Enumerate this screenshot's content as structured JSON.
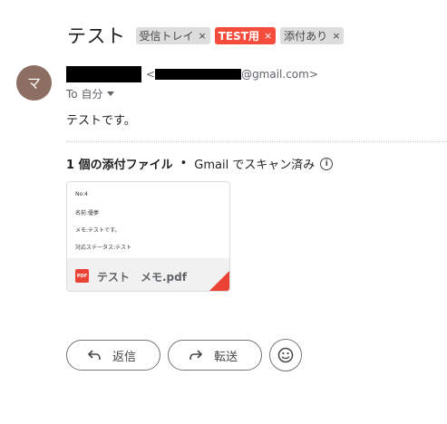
{
  "email": {
    "subject": "テスト",
    "labels": [
      {
        "text": "受信トレイ",
        "color": "#dddddd"
      },
      {
        "text": "TEST用",
        "color": "#f64c3c"
      },
      {
        "text": "添付あり",
        "color": "#dddddd"
      }
    ],
    "label_remove_glyph": "×",
    "avatar_initial": "マ",
    "sender_email_suffix": "@gmail.com>",
    "sender_email_prefix": "<",
    "to_text": "To 自分",
    "body": "テストです。"
  },
  "attachments": {
    "count_label": "1 個の添付ファイル",
    "separator": "•",
    "scan_note": "Gmail でスキャン済み",
    "file": {
      "badge": "PDF",
      "name": "テスト　メモ.pdf",
      "preview_lines": [
        "No:4",
        "名前:優夢",
        "メモ:テストです。",
        "対応ステータス:テスト"
      ]
    }
  },
  "actions": {
    "reply_label": "返信",
    "forward_label": "転送"
  }
}
